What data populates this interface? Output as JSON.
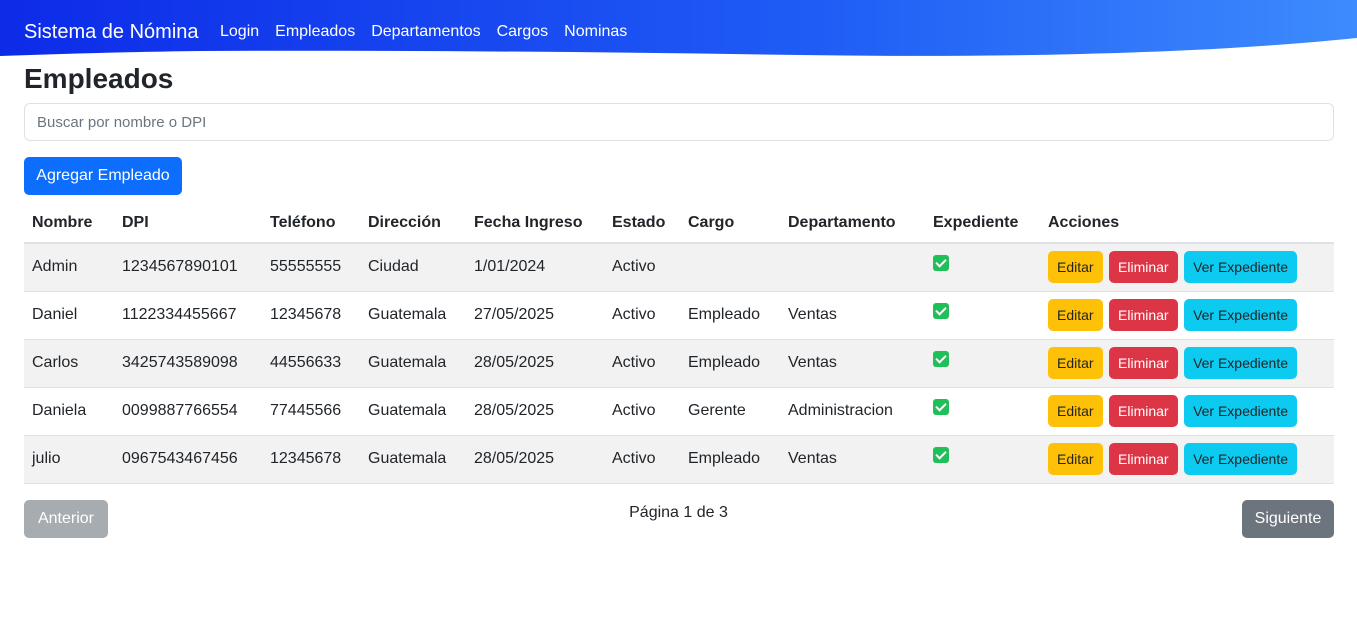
{
  "navbar": {
    "brand": "Sistema de Nómina",
    "links": [
      "Login",
      "Empleados",
      "Departamentos",
      "Cargos",
      "Nominas"
    ],
    "gradient_start": "#0d2be8",
    "gradient_end": "#3d8bfd"
  },
  "page": {
    "title": "Empleados",
    "search_placeholder": "Buscar por nombre o DPI",
    "add_button": "Agregar Empleado"
  },
  "table": {
    "headers": [
      "Nombre",
      "DPI",
      "Teléfono",
      "Dirección",
      "Fecha Ingreso",
      "Estado",
      "Cargo",
      "Departamento",
      "Expediente",
      "Acciones"
    ],
    "rows": [
      {
        "nombre": "Admin",
        "dpi": "1234567890101",
        "telefono": "55555555",
        "direccion": "Ciudad",
        "fecha": "1/01/2024",
        "estado": "Activo",
        "cargo": "",
        "departamento": "",
        "expediente": true
      },
      {
        "nombre": "Daniel",
        "dpi": "1122334455667",
        "telefono": "12345678",
        "direccion": "Guatemala",
        "fecha": "27/05/2025",
        "estado": "Activo",
        "cargo": "Empleado",
        "departamento": "Ventas",
        "expediente": true
      },
      {
        "nombre": "Carlos",
        "dpi": "3425743589098",
        "telefono": "44556633",
        "direccion": "Guatemala",
        "fecha": "28/05/2025",
        "estado": "Activo",
        "cargo": "Empleado",
        "departamento": "Ventas",
        "expediente": true
      },
      {
        "nombre": "Daniela",
        "dpi": "0099887766554",
        "telefono": "77445566",
        "direccion": "Guatemala",
        "fecha": "28/05/2025",
        "estado": "Activo",
        "cargo": "Gerente",
        "departamento": "Administracion",
        "expediente": true
      },
      {
        "nombre": "julio",
        "dpi": "0967543467456",
        "telefono": "12345678",
        "direccion": "Guatemala",
        "fecha": "28/05/2025",
        "estado": "Activo",
        "cargo": "Empleado",
        "departamento": "Ventas",
        "expediente": true
      }
    ],
    "actions": {
      "edit": "Editar",
      "delete": "Eliminar",
      "view": "Ver Expediente"
    },
    "expediente_icon": "checkbox-checked-icon"
  },
  "pagination": {
    "prev": "Anterior",
    "info": "Página 1 de 3",
    "next": "Siguiente"
  }
}
